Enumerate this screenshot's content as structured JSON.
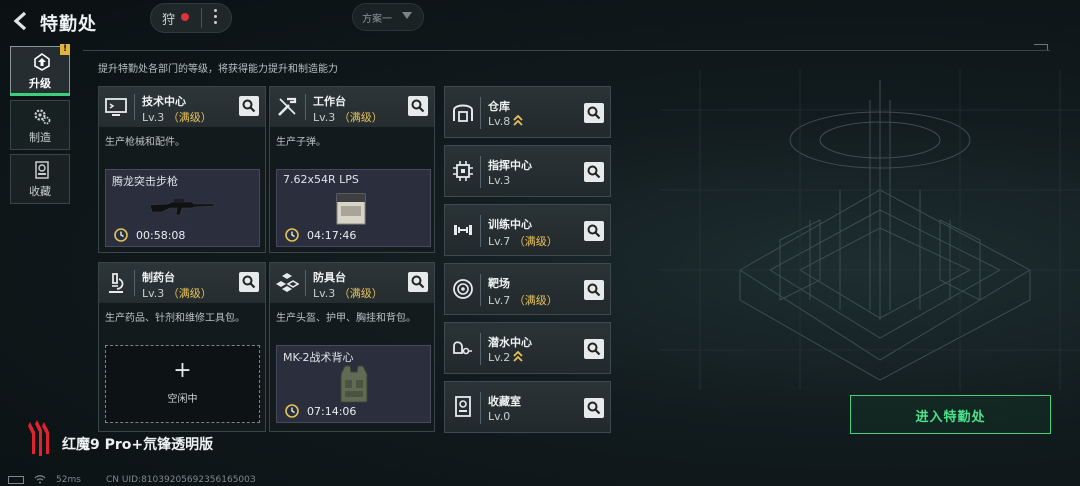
{
  "header": {
    "title": "特勤处",
    "team_label": "狩",
    "plan_label": "方案一"
  },
  "sidebar": {
    "alert_badge": "!",
    "items": [
      {
        "label": "升级",
        "icon": "upgrade-icon",
        "active": true
      },
      {
        "label": "制造",
        "icon": "gears-icon",
        "active": false
      },
      {
        "label": "收藏",
        "icon": "collection-icon",
        "active": false
      }
    ]
  },
  "description": "提升特勤处各部门的等级，将获得能力提升和制造能力",
  "production_cards": [
    {
      "name": "技术中心",
      "level": "Lv.3",
      "max_tag": "（满级）",
      "desc": "生产枪械和配件。",
      "producing": {
        "item": "腾龙突击步枪",
        "time": "00:58:08"
      }
    },
    {
      "name": "工作台",
      "level": "Lv.3",
      "max_tag": "（满级）",
      "desc": "生产子弹。",
      "producing": {
        "item": "7.62x54R LPS",
        "time": "04:17:46"
      }
    },
    {
      "name": "制药台",
      "level": "Lv.3",
      "max_tag": "（满级）",
      "desc": "生产药品、针剂和维修工具包。",
      "idle": {
        "plus": "+",
        "label": "空闲中"
      }
    },
    {
      "name": "防具台",
      "level": "Lv.3",
      "max_tag": "（满级）",
      "desc": "生产头盔、护甲、胸挂和背包。",
      "producing": {
        "item": "MK-2战术背心",
        "time": "07:14:06"
      }
    }
  ],
  "facility_cards": [
    {
      "name": "仓库",
      "level": "Lv.8",
      "max_tag": "",
      "upgradable": true,
      "icon": "warehouse-icon"
    },
    {
      "name": "指挥中心",
      "level": "Lv.3",
      "max_tag": "",
      "upgradable": false,
      "icon": "chip-icon"
    },
    {
      "name": "训练中心",
      "level": "Lv.7",
      "max_tag": "（满级）",
      "upgradable": false,
      "icon": "dumbbell-icon"
    },
    {
      "name": "靶场",
      "level": "Lv.7",
      "max_tag": "（满级）",
      "upgradable": false,
      "icon": "target-icon"
    },
    {
      "name": "潜水中心",
      "level": "Lv.2",
      "max_tag": "",
      "upgradable": true,
      "icon": "diving-mask-icon"
    },
    {
      "name": "收藏室",
      "level": "Lv.0",
      "max_tag": "",
      "upgradable": false,
      "icon": "collection-room-icon"
    }
  ],
  "enter_button": "进入特勤处",
  "brand": "红魔9 Pro+氘锋透明版",
  "status": {
    "ping": "52ms",
    "uid": "CN UID:8103920569235616500З"
  },
  "colors": {
    "accent_green": "#42d27f",
    "max_gold": "#e8c158",
    "record_red": "#d8343d",
    "badge_yellow": "#e1b43d"
  }
}
